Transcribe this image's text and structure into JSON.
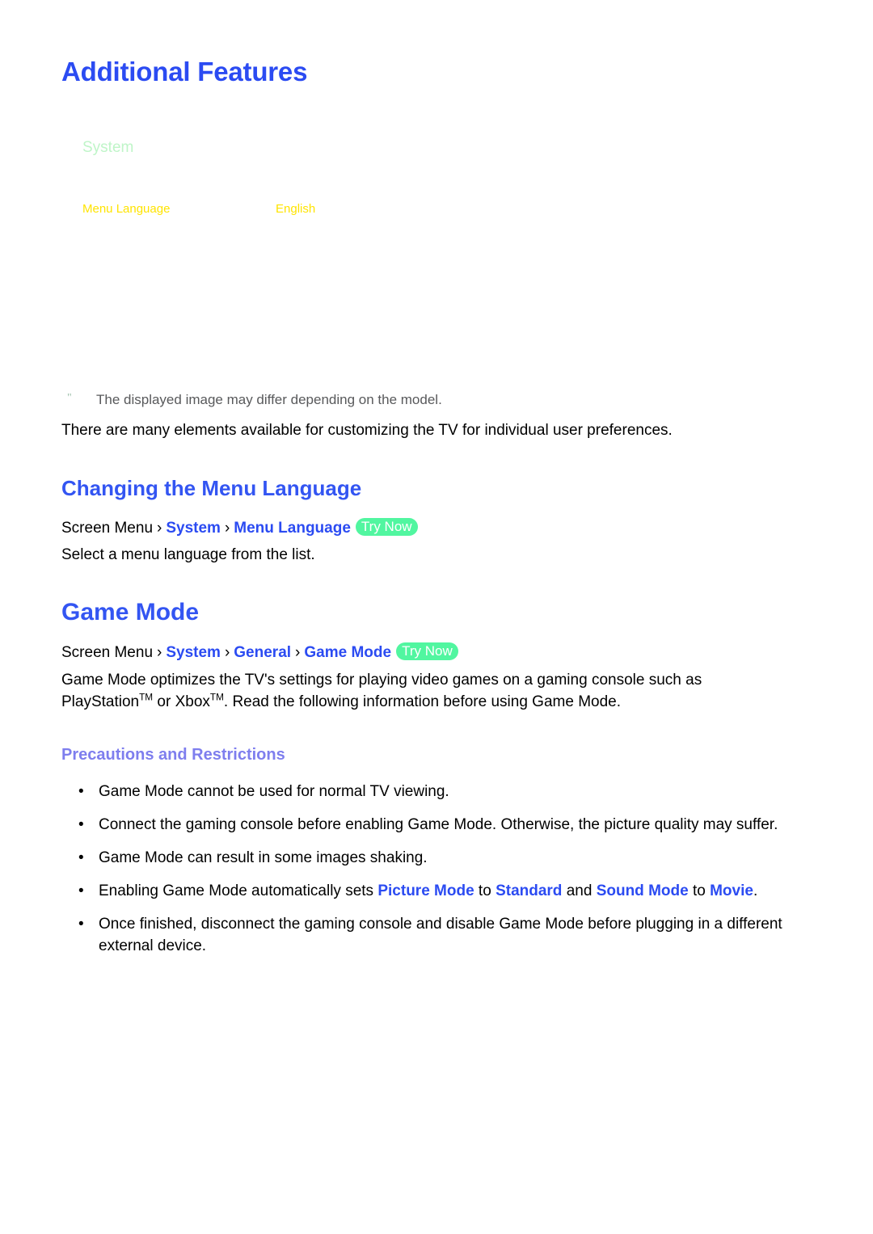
{
  "page": {
    "title": "Additional Features"
  },
  "tv_menu": {
    "title": "System",
    "rows": [
      {
        "label": "Menu Language",
        "value": "English"
      }
    ]
  },
  "note": {
    "marker": "\"",
    "text": "The displayed image may differ depending on the model."
  },
  "intro": {
    "text": "There are many elements available for customizing the TV for individual user preferences."
  },
  "sections": {
    "menu_language": {
      "heading": "Changing the Menu Language",
      "path": {
        "root": "Screen Menu",
        "separator": "›",
        "nodes": [
          "System",
          "Menu Language"
        ],
        "badge": "Try Now"
      },
      "body": "Select a menu language from the list."
    },
    "game_mode": {
      "heading": "Game Mode",
      "path": {
        "root": "Screen Menu",
        "separator": "›",
        "nodes": [
          "System",
          "General",
          "Game Mode"
        ],
        "badge": "Try Now"
      },
      "description_part1": "Game Mode optimizes the TV's settings for playing video games on a gaming console such as PlayStation",
      "description_tm1": "TM",
      "description_part2": " or Xbox",
      "description_tm2": "TM",
      "description_part3": ". Read the following information before using Game Mode.",
      "subheading": "Precautions and Restrictions",
      "bullet_marker": "•",
      "bullets": [
        {
          "segments": [
            {
              "text": "Game Mode cannot be used for normal TV viewing.",
              "style": "plain"
            }
          ]
        },
        {
          "segments": [
            {
              "text": "Connect the gaming console before enabling Game Mode. Otherwise, the picture quality may suffer.",
              "style": "plain"
            }
          ]
        },
        {
          "segments": [
            {
              "text": "Game Mode can result in some images shaking.",
              "style": "plain"
            }
          ]
        },
        {
          "segments": [
            {
              "text": "Enabling Game Mode automatically sets ",
              "style": "plain"
            },
            {
              "text": "Picture Mode",
              "style": "term"
            },
            {
              "text": " to ",
              "style": "plain"
            },
            {
              "text": "Standard",
              "style": "term"
            },
            {
              "text": " and ",
              "style": "plain"
            },
            {
              "text": "Sound Mode",
              "style": "term"
            },
            {
              "text": " to ",
              "style": "plain"
            },
            {
              "text": "Movie",
              "style": "term"
            },
            {
              "text": ".",
              "style": "plain"
            }
          ]
        },
        {
          "segments": [
            {
              "text": "Once finished, disconnect the gaming console and disable Game Mode before plugging in a different external device.",
              "style": "plain"
            }
          ]
        }
      ]
    }
  },
  "colors": {
    "heading_blue": "#3355F2",
    "title_blue": "#2B4BF2",
    "subheading_periwinkle": "#7E7EEE",
    "badge_green": "#51F6A0",
    "menu_yellow": "#FFE400",
    "menu_green": "#BFF5C8",
    "note_gray": "#58595B"
  }
}
